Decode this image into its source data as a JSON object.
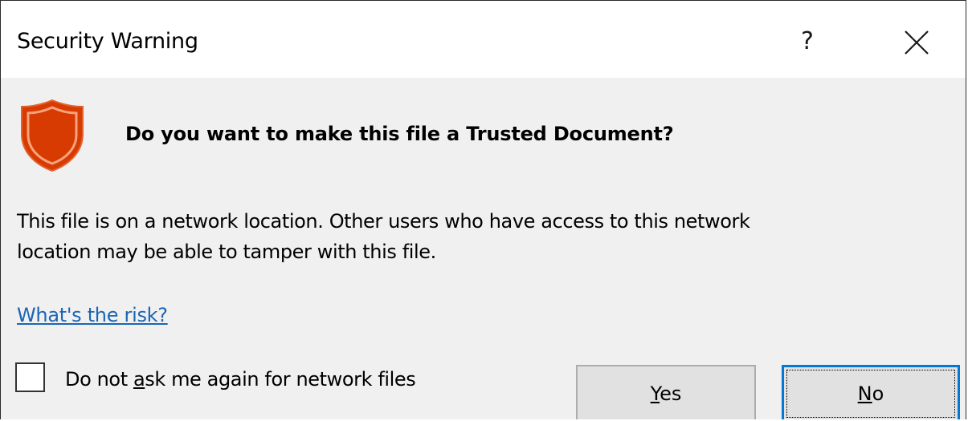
{
  "dialog": {
    "title": "Security Warning",
    "help_label": "?",
    "close_icon": "close-icon",
    "shield_icon": "shield-icon",
    "colors": {
      "shield_fill": "#d83b01",
      "shield_outline": "#f7a37c",
      "link": "#1a66b5",
      "focus": "#0078d7"
    },
    "headline": "Do you want to make this file a Trusted Document?",
    "body_line1": "This file is on a network location. Other users who have access to this network",
    "body_line2": "location may be able to tamper with this file.",
    "risk_link": "What's the risk?",
    "checkbox": {
      "checked": false,
      "label_pre": "Do not ",
      "label_mnemonic": "a",
      "label_post": "sk me again for network files"
    },
    "yes_button": {
      "mnemonic": "Y",
      "rest": "es"
    },
    "no_button": {
      "mnemonic": "N",
      "rest": "o"
    }
  }
}
